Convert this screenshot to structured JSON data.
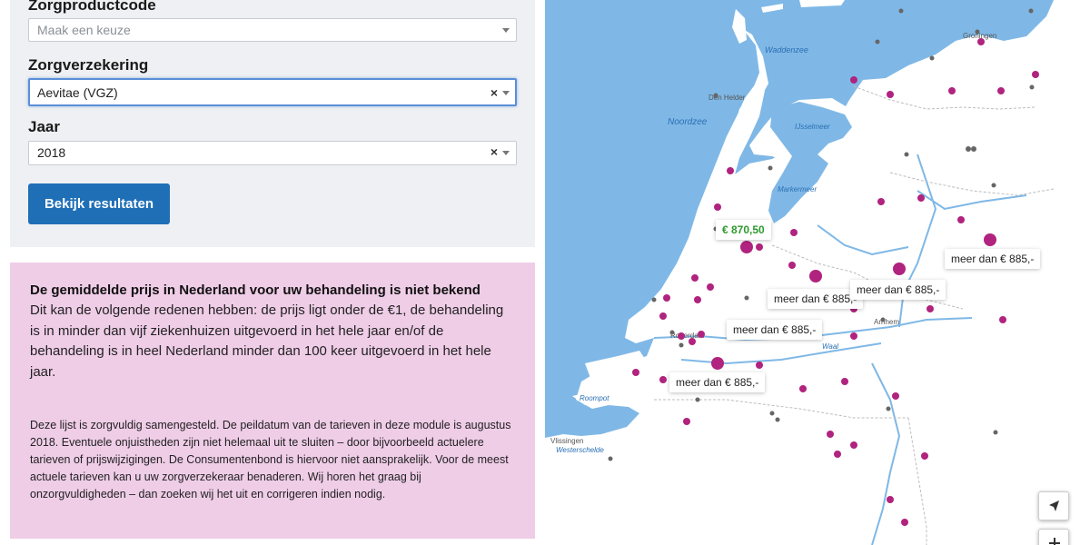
{
  "form": {
    "fields": [
      {
        "label": "Zorgproductcode",
        "value": "",
        "placeholder": "Maak een keuze"
      },
      {
        "label": "Zorgverzekering",
        "value": "Aevitae (VGZ)",
        "placeholder": ""
      },
      {
        "label": "Jaar",
        "value": "2018",
        "placeholder": ""
      }
    ],
    "clear_glyph": "×",
    "submit_label": "Bekijk resultaten"
  },
  "info": {
    "title": "De gemiddelde prijs in Nederland voor uw behandeling is niet bekend",
    "body": "Dit kan de volgende redenen hebben: de prijs ligt onder de €1, de behandeling is in minder dan vijf ziekenhuizen uitgevoerd in het hele jaar en/of de behandeling is in heel Nederland minder dan 100 keer uitgevoerd in het hele jaar.",
    "disclaimer": "Deze lijst is zorgvuldig samengesteld. De peildatum van de tarieven in deze module is augustus 2018. Eventuele onjuistheden zijn niet helemaal uit te sluiten – door bijvoorbeeld actuelere tarieven of prijswijzigingen. De Consumentenbond is hiervoor niet aansprakelijk. Voor de meest actuele tarieven kan u uw zorgverzekeraar benaderen. Wij horen het graag bij onzorgvuldigheden – dan zoeken wij het uit en corrigeren indien nodig."
  },
  "map": {
    "colors": {
      "water": "#7fb8e6",
      "land": "#ffffff",
      "marker": "#b0237e",
      "city": "#666666",
      "river": "#7fb8e6"
    },
    "place_labels": {
      "waddenzee": "Waddenzee",
      "groningen": "Groningen",
      "den_helder": "Den Helder",
      "noordzee": "Noordzee",
      "ijsselmeer": "IJsselmeer",
      "markermeer": "Markermeer",
      "arnhem": "Arnhem",
      "waal": "Waal",
      "rotterdam": "Rotterdam",
      "roompot": "Roompot",
      "vlissingen": "Vlissingen",
      "westerschelde": "Westerschelde"
    },
    "price_labels": [
      {
        "text": "€ 870,50",
        "highlight": true
      },
      {
        "text": "meer dan € 885,-",
        "highlight": false
      },
      {
        "text": "meer dan € 885,-",
        "highlight": false
      },
      {
        "text": "meer dan € 885,-",
        "highlight": false
      },
      {
        "text": "meer dan € 885,-",
        "highlight": false
      },
      {
        "text": "meer dan € 885,-",
        "highlight": false
      }
    ],
    "controls": {
      "locate_icon": "navigation-arrow-icon"
    }
  }
}
